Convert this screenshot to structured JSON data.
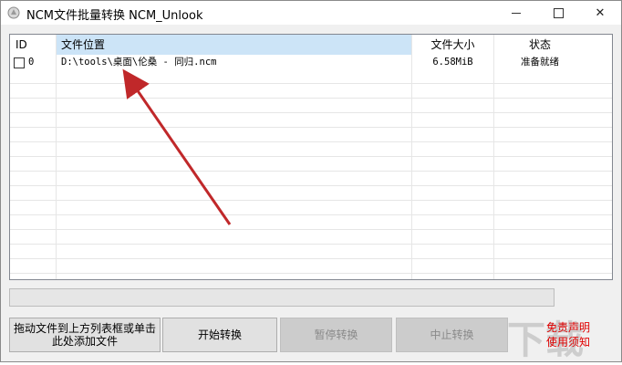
{
  "window": {
    "title": "NCM文件批量转换 NCM_Unlook",
    "controls": {
      "minimize": "—",
      "maximize": "☐",
      "close": "✕"
    }
  },
  "table": {
    "headers": {
      "id": "ID",
      "path": "文件位置",
      "size": "文件大小",
      "status": "状态"
    },
    "rows": [
      {
        "checked": false,
        "id": "0",
        "path": "D:\\tools\\桌面\\伦桑 - 同归.ncm",
        "size": "6.58MiB",
        "status": "准备就绪"
      }
    ]
  },
  "buttons": {
    "drag": "拖动文件到上方列表框或单击此处添加文件",
    "start": "开始转换",
    "pause": "暂停转换",
    "stop": "中止转换"
  },
  "notice": "免责声明 使用须知",
  "colors": {
    "arrow": "#c0282a",
    "notice": "#e00000",
    "header_selected": "#cce4f7"
  }
}
